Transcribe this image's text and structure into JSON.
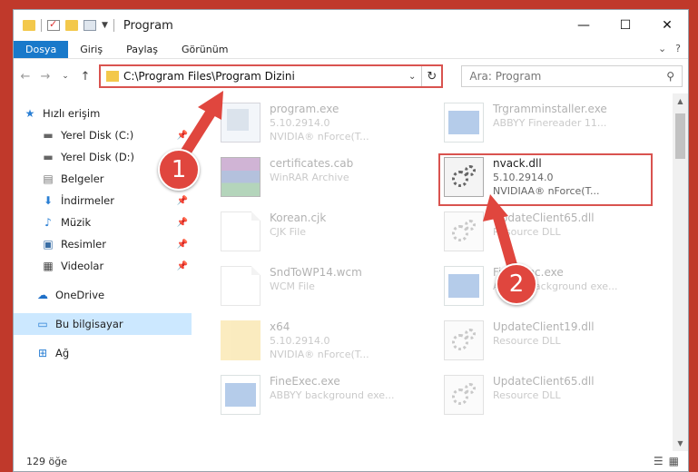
{
  "window": {
    "title": "Program"
  },
  "ribbon": {
    "tabs": [
      "Dosya",
      "Giriş",
      "Paylaş",
      "Görünüm"
    ],
    "active": 0
  },
  "address": {
    "path": "C:\\Program Files\\Program Dizini"
  },
  "search": {
    "placeholder": "Ara: Program"
  },
  "nav": {
    "items": [
      {
        "label": "Hızlı erişim",
        "icon": "star-icon"
      },
      {
        "label": "Yerel Disk (C:)",
        "icon": "drive-icon",
        "pinned": true
      },
      {
        "label": "Yerel Disk (D:)",
        "icon": "drive-icon",
        "pinned": true
      },
      {
        "label": "Belgeler",
        "icon": "document-icon",
        "pinned": true
      },
      {
        "label": "İndirmeler",
        "icon": "download-icon",
        "pinned": true
      },
      {
        "label": "Müzik",
        "icon": "music-icon",
        "pinned": true
      },
      {
        "label": "Resimler",
        "icon": "pictures-icon",
        "pinned": true
      },
      {
        "label": "Videolar",
        "icon": "video-icon",
        "pinned": true
      },
      {
        "label": "OneDrive",
        "icon": "cloud-icon"
      },
      {
        "label": "Bu bilgisayar",
        "icon": "computer-icon",
        "selected": true
      },
      {
        "label": "Ağ",
        "icon": "network-icon"
      }
    ]
  },
  "files": [
    {
      "name": "program.exe",
      "desc1": "5.10.2914.0",
      "desc2": "NVIDIA® nForce(T...",
      "icon": "exe"
    },
    {
      "name": "Trgramminstaller.exe",
      "desc1": "ABBYY Finereader 11...",
      "desc2": "",
      "icon": "app"
    },
    {
      "name": "certificates.cab",
      "desc1": "WinRAR Archive",
      "desc2": "",
      "icon": "rar"
    },
    {
      "name": "nvack.dll",
      "desc1": "5.10.2914.0",
      "desc2": "NVIDIAA® nForce(T...",
      "icon": "dll"
    },
    {
      "name": "Korean.cjk",
      "desc1": "CJK File",
      "desc2": "",
      "icon": "doc"
    },
    {
      "name": "UpdateClient65.dll",
      "desc1": "Resource DLL",
      "desc2": "",
      "icon": "dll"
    },
    {
      "name": "SndToWP14.wcm",
      "desc1": "WCM File",
      "desc2": "",
      "icon": "doc"
    },
    {
      "name": "FineExec.exe",
      "desc1": "ABBYY background exe...",
      "desc2": "",
      "icon": "app"
    },
    {
      "name": "x64",
      "desc1": "5.10.2914.0",
      "desc2": "NVIDIA® nForce(T...",
      "icon": "folder"
    },
    {
      "name": "UpdateClient19.dll",
      "desc1": "Resource DLL",
      "desc2": "",
      "icon": "dll"
    },
    {
      "name": "FineExec.exe",
      "desc1": "ABBYY background exe...",
      "desc2": "",
      "icon": "app"
    },
    {
      "name": "UpdateClient65.dll",
      "desc1": "Resource DLL",
      "desc2": "",
      "icon": "dll"
    }
  ],
  "callouts": [
    "1",
    "2"
  ],
  "status": {
    "count": "129 öğe"
  },
  "colors": {
    "accent": "#1979ca",
    "highlight": "#d9534f",
    "callout": "#e0463e",
    "selection": "#cce8ff"
  }
}
